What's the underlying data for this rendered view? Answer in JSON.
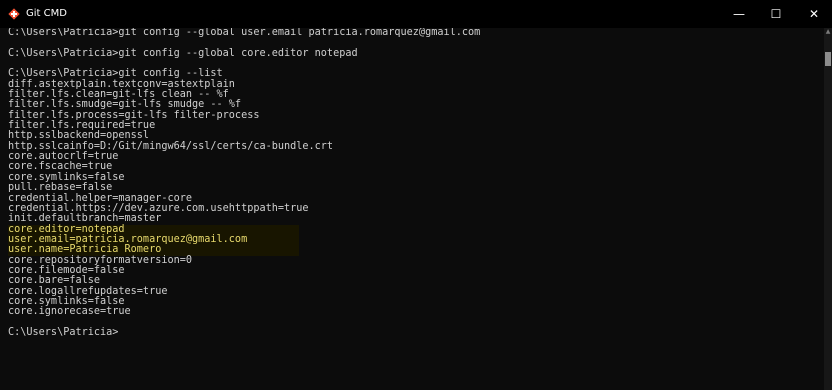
{
  "window": {
    "title": "Git CMD",
    "minimize": "—",
    "maximize": "☐",
    "close": "✕"
  },
  "icons": {
    "app": "git-icon",
    "minimize": "minimize-icon",
    "maximize": "maximize-icon",
    "close": "close-icon"
  },
  "colors": {
    "terminal_background": "#0c0c0c",
    "terminal_text": "#d0d0d0",
    "highlight_text": "#e7d96c",
    "git_icon": "#f05133"
  },
  "terminal": {
    "lines": [
      "C:\\Users\\Patricia>git config --global user.email patricia.romarquez@gmail.com",
      "",
      "C:\\Users\\Patricia>git config --global core.editor notepad",
      "",
      "C:\\Users\\Patricia>git config --list",
      "diff.astextplain.textconv=astextplain",
      "filter.lfs.clean=git-lfs clean -- %f",
      "filter.lfs.smudge=git-lfs smudge -- %f",
      "filter.lfs.process=git-lfs filter-process",
      "filter.lfs.required=true",
      "http.sslbackend=openssl",
      "http.sslcainfo=D:/Git/mingw64/ssl/certs/ca-bundle.crt",
      "core.autocrlf=true",
      "core.fscache=true",
      "core.symlinks=false",
      "pull.rebase=false",
      "credential.helper=manager-core",
      "credential.https://dev.azure.com.usehttppath=true",
      "init.defaultbranch=master",
      "core.editor=notepad",
      "user.email=patricia.romarquez@gmail.com",
      "user.name=Patricia Romero",
      "core.repositoryformatversion=0",
      "core.filemode=false",
      "core.bare=false",
      "core.logallrefupdates=true",
      "core.symlinks=false",
      "core.ignorecase=true",
      "",
      "C:\\Users\\Patricia>"
    ]
  }
}
